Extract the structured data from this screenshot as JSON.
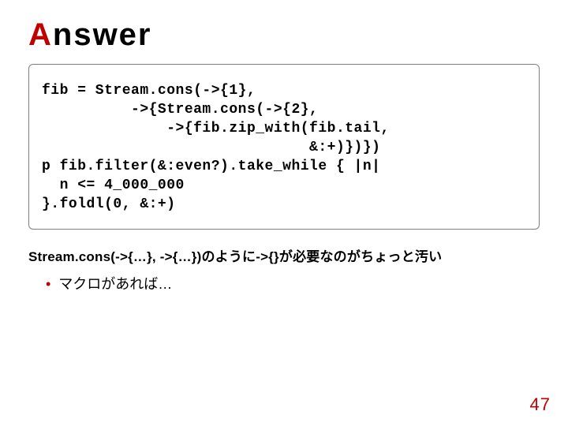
{
  "title": {
    "accent": "A",
    "rest": "nswer"
  },
  "code": {
    "l1": "fib = Stream.cons(->{1},",
    "l2": "          ->{Stream.cons(->{2},",
    "l3": "              ->{fib.zip_with(fib.tail,",
    "l4": "                              &:+)})})",
    "l5": "p fib.filter(&:even?).take_while { |n|",
    "l6": "  n <= 4_000_000",
    "l7": "}.foldl(0, &:+)"
  },
  "note": "Stream.cons(->{…}, ->{…})のように->{}が必要なのがちょっと汚い",
  "bullet": "マクロがあれば…",
  "page": "47"
}
